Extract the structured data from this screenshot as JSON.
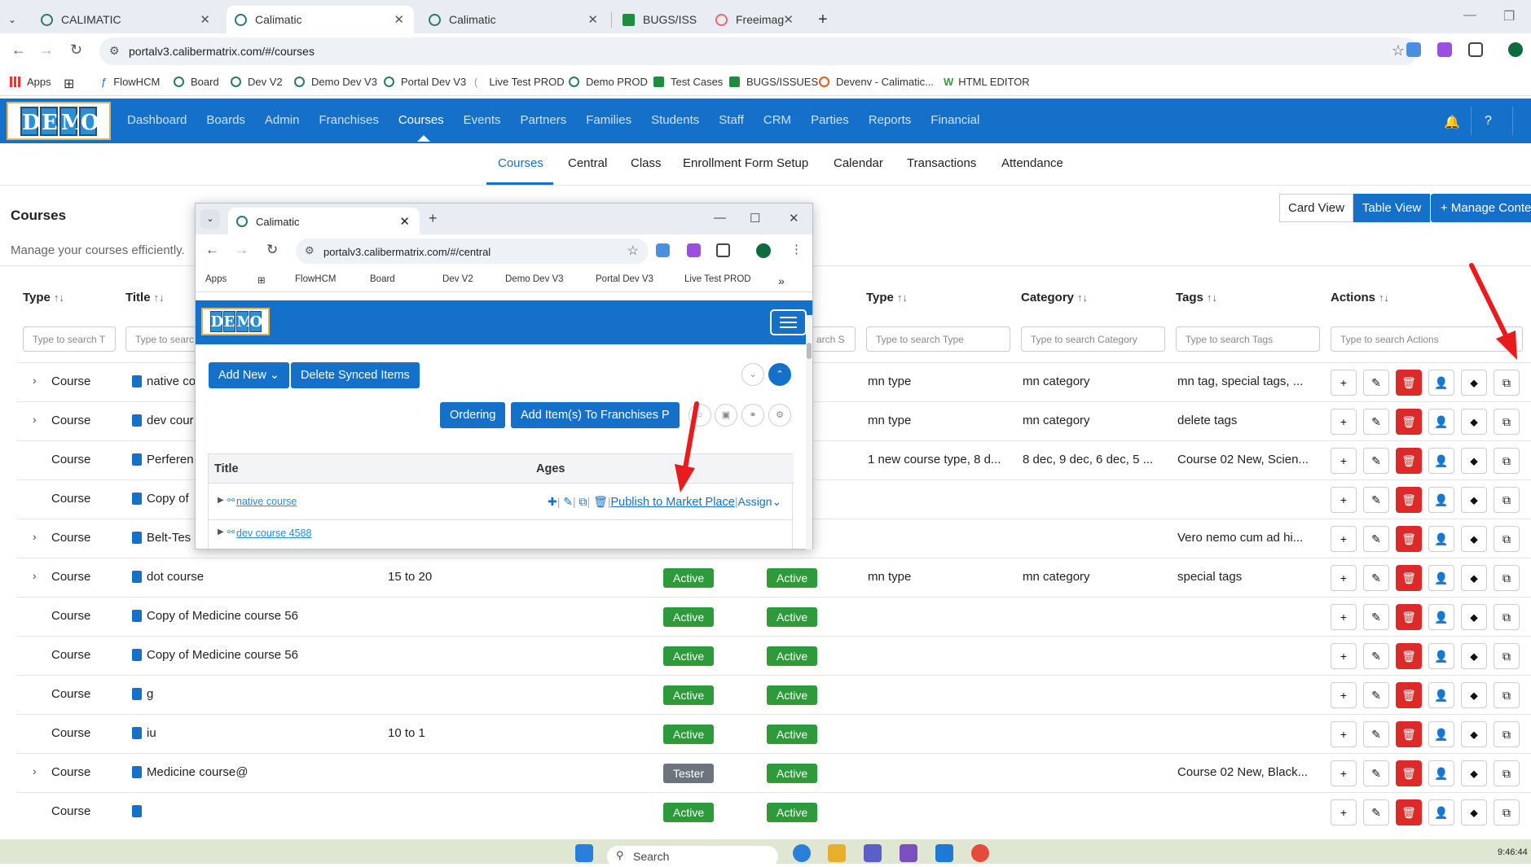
{
  "browser": {
    "tabs": [
      {
        "title": "CALIMATIC"
      },
      {
        "title": "Calimatic"
      },
      {
        "title": "Calimatic"
      },
      {
        "title": "BUGS/ISS"
      },
      {
        "title": "Freeimag"
      }
    ],
    "url": "portalv3.calibermatrix.com/#/courses",
    "bookmarks": [
      "Apps",
      "FlowHCM",
      "Board",
      "Dev V2",
      "Demo Dev V3",
      "Portal Dev V3",
      "Live Test PROD",
      "Demo PROD",
      "Test Cases",
      "BUGS/ISSUES",
      "Devenv - Calimatic...",
      "HTML EDITOR"
    ]
  },
  "app": {
    "logo_letters": [
      "D",
      "E",
      "M",
      "O"
    ],
    "nav": [
      "Dashboard",
      "Boards",
      "Admin",
      "Franchises",
      "Courses",
      "Events",
      "Partners",
      "Families",
      "Students",
      "Staff",
      "CRM",
      "Parties",
      "Reports",
      "Financial"
    ],
    "active_nav": "Courses",
    "subnav": [
      "Courses",
      "Central",
      "Class",
      "Enrollment Form Setup",
      "Calendar",
      "Transactions",
      "Attendance"
    ],
    "page_title": "Courses",
    "page_subtitle": "Manage your courses efficiently.",
    "view_card": "Card View",
    "view_table": "Table View",
    "manage_button": "+ Manage Conte"
  },
  "table": {
    "headers": {
      "type": "Type",
      "title": "Title",
      "type2": "Type",
      "category": "Category",
      "tags": "Tags",
      "actions": "Actions"
    },
    "filters": {
      "type": "Type to search T",
      "title": "Type to searc",
      "central": "arch S",
      "type2": "Type to search Type",
      "category": "Type to search Category",
      "tags": "Type to search Tags",
      "actions": "Type to search Actions"
    },
    "rows": [
      {
        "chev": "›",
        "type": "Course",
        "title": "native co",
        "ages": "",
        "status1": "",
        "status2": "",
        "ctype": "mn type",
        "category": "mn category",
        "tags": "mn tag, special tags, ..."
      },
      {
        "chev": "›",
        "type": "Course",
        "title": "dev cour",
        "ages": "",
        "status1": "",
        "status2": "",
        "ctype": "mn type",
        "category": "mn category",
        "tags": "delete tags"
      },
      {
        "chev": "",
        "type": "Course",
        "title": "Perferen",
        "ages": "",
        "status1": "",
        "status2": "",
        "ctype": "1 new course type, 8 d...",
        "category": "8 dec, 9 dec, 6 dec, 5 ...",
        "tags": "Course 02 New, Scien..."
      },
      {
        "chev": "",
        "type": "Course",
        "title": "Copy of",
        "ages": "",
        "status1": "",
        "status2": "",
        "ctype": "",
        "category": "",
        "tags": ""
      },
      {
        "chev": "›",
        "type": "Course",
        "title": "Belt-Tes",
        "ages": "",
        "status1": "",
        "status2": "",
        "ctype": "",
        "category": "",
        "tags": "Vero nemo cum ad hi..."
      },
      {
        "chev": "›",
        "type": "Course",
        "title": "dot course",
        "ages": "15 to 20",
        "status1": "Active",
        "status2": "Active",
        "ctype": "mn type",
        "category": "mn category",
        "tags": "special tags"
      },
      {
        "chev": "",
        "type": "Course",
        "title": "Copy of Medicine course 56",
        "ages": "",
        "status1": "Active",
        "status2": "Active",
        "ctype": "",
        "category": "",
        "tags": ""
      },
      {
        "chev": "",
        "type": "Course",
        "title": "Copy of Medicine course 56",
        "ages": "",
        "status1": "Active",
        "status2": "Active",
        "ctype": "",
        "category": "",
        "tags": ""
      },
      {
        "chev": "",
        "type": "Course",
        "title": "g",
        "ages": "",
        "status1": "Active",
        "status2": "Active",
        "ctype": "",
        "category": "",
        "tags": ""
      },
      {
        "chev": "",
        "type": "Course",
        "title": "iu",
        "ages": "10 to 1",
        "status1": "Active",
        "status2": "Active",
        "ctype": "",
        "category": "",
        "tags": ""
      },
      {
        "chev": "›",
        "type": "Course",
        "title": "Medicine course@",
        "ages": "",
        "status1": "Tester",
        "status2": "Active",
        "ctype": "",
        "category": "",
        "tags": "Course 02 New, Black..."
      },
      {
        "chev": "",
        "type": "Course",
        "title": "",
        "ages": "",
        "status1": "Active",
        "status2": "Active",
        "ctype": "",
        "category": "",
        "tags": ""
      }
    ],
    "action_icons": [
      "plus-icon",
      "edit-icon",
      "delete-icon",
      "assign-user-icon",
      "tag-icon",
      "copy-icon"
    ],
    "action_glyphs": [
      "+",
      "✎",
      "🗑",
      "👤",
      "⬥",
      "⧉"
    ]
  },
  "popup": {
    "tab_title": "Calimatic",
    "url": "portalv3.calibermatrix.com/#/central",
    "bookmarks": [
      "Apps",
      "FlowHCM",
      "Board",
      "Dev V2",
      "Demo Dev V3",
      "Portal Dev V3",
      "Live Test PROD"
    ],
    "logo_letters": [
      "D",
      "E",
      "M",
      "O"
    ],
    "add_new": "Add New",
    "delete_synced": "Delete Synced Items",
    "ordering": "Ordering",
    "add_items": "Add Item(s) To Franchises P",
    "col_title": "Title",
    "col_ages": "Ages",
    "rows": [
      {
        "title": "native course"
      },
      {
        "title": "dev course 4588"
      }
    ],
    "publish_link": "Publish to Market Place",
    "assign_link": "Assign"
  },
  "taskbar": {
    "search": "Search",
    "clock": "9:46:44"
  },
  "colors": {
    "brand": "#1470c8",
    "active_badge": "#2f9a3a",
    "tester_badge": "#6c757d",
    "delete": "#dc2a2a",
    "annotation_arrow": "#e81c1c"
  }
}
